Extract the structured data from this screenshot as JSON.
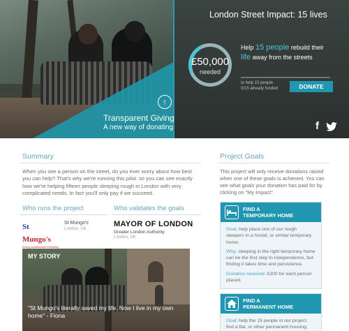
{
  "hero": {
    "title": "London Street Impact: 15 lives",
    "caption_title": "Transparent Giving",
    "caption_sub": "A new way of donating",
    "goal_amount": "£50,000",
    "goal_needed": "needed",
    "help_prefix": "Help ",
    "help_count": "15 people",
    "help_suffix": " rebuild their",
    "life_word": "life",
    "life_suffix": " away from the streets",
    "to_help": "to help 15 people",
    "funded": "0/15 already funded",
    "funded_fraction": 0.0,
    "donate_label": "DONATE",
    "accent_color": "#2196b0",
    "social": {
      "facebook_icon": "f",
      "twitter_icon": "twitter-bird"
    }
  },
  "summary": {
    "title": "Summary",
    "text": "When you see a person on the street, do you ever worry about how best you can help? That's why we're running this pilot: so you can see exactly how we're helping fifteen people sleeping rough in London with very complicated needs. In fact you'll only pay if we succeed."
  },
  "who_runs": {
    "title": "Who runs the project",
    "logo_st": "St ",
    "logo_mungo": "Mungo's",
    "logo_tag": "Ending homelessness Rebuilding lives",
    "name": "St Mungo's",
    "location": "London, UK"
  },
  "who_validates": {
    "title": "Who validates the goals",
    "logo": "MAYOR OF LONDON",
    "name": "Greater London Authority",
    "location": "London, UK"
  },
  "story": {
    "label": "MY STORY",
    "quote": "\"St Mungo's literally saved my life. Now I live in my own home\" - Fiona"
  },
  "goals": {
    "title": "Project Goals",
    "intro": "This project will only receive donations raised when one of these goals is achieved. You can see what goals your donation has paid for by clicking on \"My Impact\".",
    "cards": [
      {
        "head1": "FIND A",
        "head2": "TEMPORARY HOME",
        "goal_key": "Goal:",
        "goal_text": " help place one of our rough sleepers in a hostel, or similar temporary home.",
        "why_key": "Why:",
        "why_text": " sleeping in the right temporary home can be the first step to independence, but finding it takes time and persistence.",
        "donation_key": "Donation received:",
        "donation_text": " £200 for each person placed."
      },
      {
        "head1": "FIND A",
        "head2": "PERMANENT HOME",
        "goal_key": "Goal:",
        "goal_text": " help the 15 people in our project find a flat, or other permanent housing."
      }
    ]
  }
}
